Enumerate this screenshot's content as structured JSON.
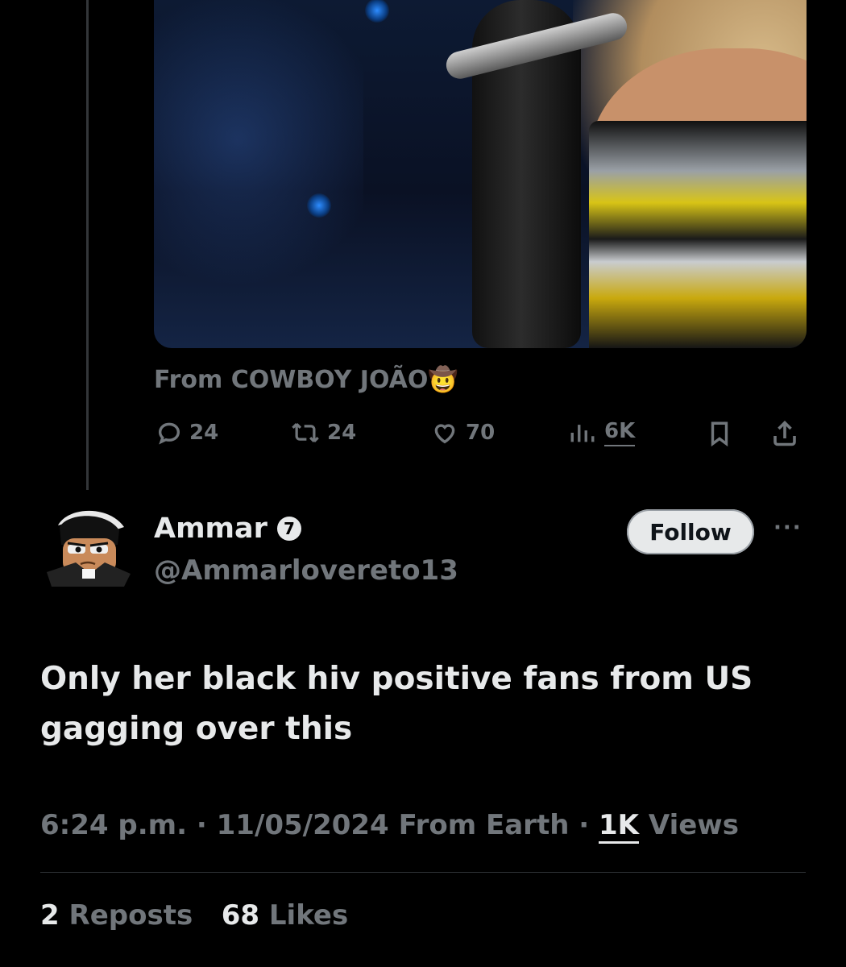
{
  "quoted_tweet": {
    "media": {
      "mute_icon": "speaker-muted-icon"
    },
    "source_prefix": "From",
    "source_name": "COWBOY JOÃO",
    "source_emoji": "🤠",
    "actions": {
      "replies": "24",
      "reposts": "24",
      "likes": "70",
      "views": "6K"
    }
  },
  "author": {
    "display_name": "Ammar",
    "badge": "7",
    "handle": "@Ammarlovereto13",
    "follow_label": "Follow",
    "more_label": "···"
  },
  "tweet": {
    "line1": "Only her black hiv positive fans from US",
    "line2": "gagging over this"
  },
  "meta": {
    "time": "6:24 p.m.",
    "sep": "·",
    "date": "11/05/2024",
    "location": "From Earth",
    "views_count": "1K",
    "views_label": "Views"
  },
  "stats": {
    "reposts_count": "2",
    "reposts_label": "Reposts",
    "likes_count": "68",
    "likes_label": "Likes"
  },
  "colors": {
    "background": "#000000",
    "primary_text": "#e7e9ea",
    "secondary_text": "#71767b",
    "divider": "#2f3336"
  }
}
